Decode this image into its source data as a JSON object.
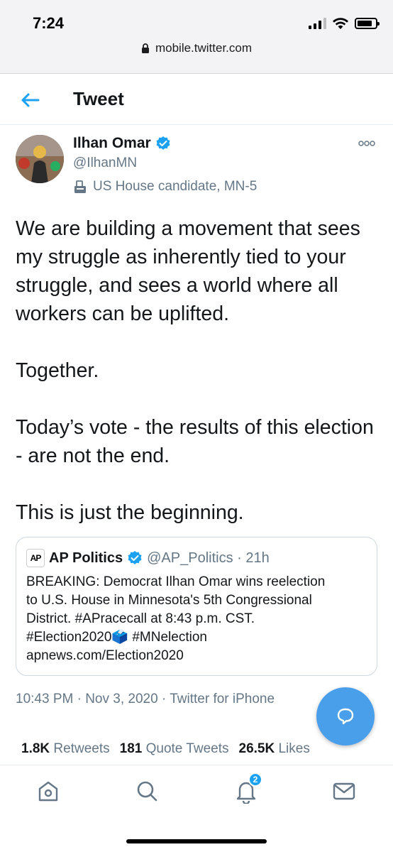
{
  "status_bar": {
    "time": "7:24",
    "url": "mobile.twitter.com",
    "signal_bars_active": 3,
    "signal_bars_total": 4,
    "battery_level": 0.85
  },
  "header": {
    "title": "Tweet"
  },
  "tweet": {
    "author_name": "Ilhan Omar",
    "author_handle": "@IlhanMN",
    "author_label": "US House candidate, MN-5",
    "paragraphs": [
      "We are building a movement that sees my struggle as inherently tied to your struggle, and sees a world where all workers can be uplifted.",
      "Together.",
      "Today’s vote - the results of this election - are not the end.",
      "This is just the beginning."
    ],
    "quote": {
      "logo_text": "AP",
      "name": "AP Politics",
      "handle_time": "@AP_Politics · 21h",
      "body_lines": [
        "BREAKING: Democrat Ilhan Omar wins reelection",
        "to U.S. House in Minnesota's 5th Congressional",
        "District. #APracecall at 8:43 p.m. CST.",
        "#Election2020🗳️ #MNelection",
        "apnews.com/Election2020"
      ]
    },
    "timestamp": "10:43 PM · Nov 3, 2020 · Twitter for iPhone",
    "stats": {
      "retweets_count": "1.8K",
      "retweets_label": "Retweets",
      "quotes_count": "181",
      "quotes_label": "Quote Tweets",
      "likes_count": "26.5K",
      "likes_label": "Likes"
    }
  },
  "bottom_nav": {
    "notifications_badge": "2"
  },
  "colors": {
    "twitter_blue": "#1da1f2",
    "fab_blue": "#4a9fea",
    "secondary_text": "#657786",
    "primary_text": "#14171a"
  }
}
